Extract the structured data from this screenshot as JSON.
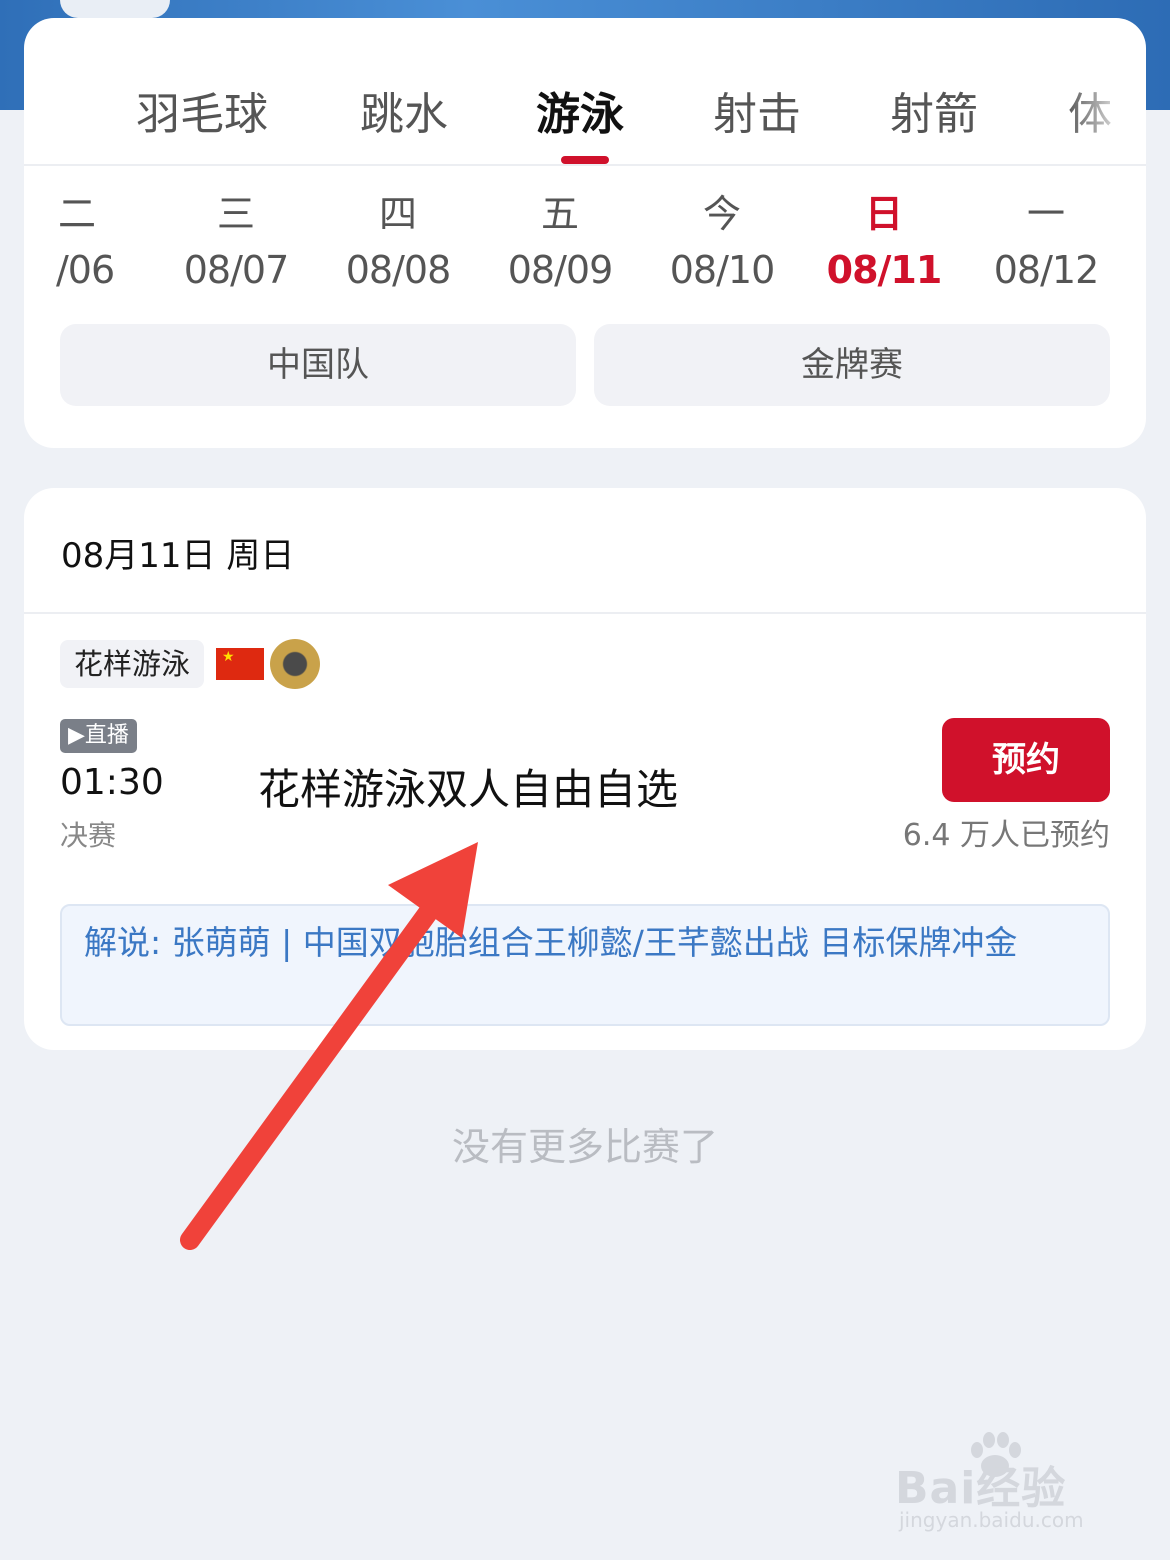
{
  "sport_tabs": [
    "羽毛球",
    "跳水",
    "游泳",
    "射击",
    "射箭",
    "体"
  ],
  "active_tab_index": 2,
  "dates": [
    {
      "weekday": "二",
      "date": "/06"
    },
    {
      "weekday": "三",
      "date": "08/07"
    },
    {
      "weekday": "四",
      "date": "08/08"
    },
    {
      "weekday": "五",
      "date": "08/09"
    },
    {
      "weekday": "今",
      "date": "08/10"
    },
    {
      "weekday": "日",
      "date": "08/11"
    },
    {
      "weekday": "一",
      "date": "08/12"
    }
  ],
  "active_date_index": 5,
  "filters": {
    "china_team": "中国队",
    "gold_medal": "金牌赛"
  },
  "schedule": {
    "date_header": "08月11日 周日",
    "event": {
      "sport_tag": "花样游泳",
      "live_badge": "直播",
      "time": "01:30",
      "stage": "决赛",
      "title": "花样游泳双人自由自选",
      "reserve_label": "预约",
      "reserve_count": "6.4 万人已预约",
      "commentary": "解说: 张萌萌 | 中国双胞胎组合王柳懿/王芊懿出战 目标保牌冲金"
    }
  },
  "no_more_text": "没有更多比赛了",
  "watermark": {
    "logo": "Bai经验",
    "url": "jingyan.baidu.com"
  },
  "colors": {
    "accent": "#d0112b",
    "commentary_text": "#3b78c4",
    "arrow": "#f0423a"
  }
}
